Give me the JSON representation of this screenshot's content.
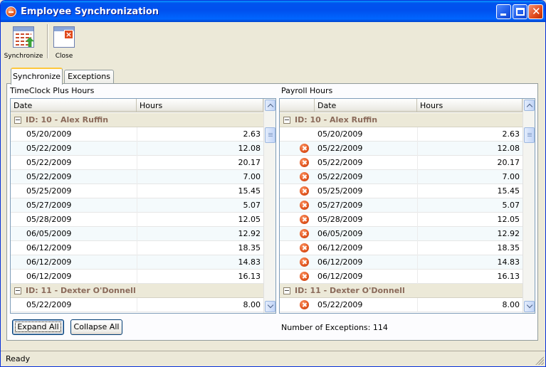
{
  "window": {
    "title": "Employee Synchronization"
  },
  "toolbar": {
    "synchronize_label": "Synchronize",
    "close_label": "Close"
  },
  "tabs": [
    {
      "label": "Synchronize",
      "active": true
    },
    {
      "label": "Exceptions",
      "active": false
    }
  ],
  "left_panel": {
    "title": "TimeClock Plus Hours",
    "columns": [
      "Date",
      "Hours"
    ],
    "groups": [
      {
        "label": "ID: 10 - Alex Ruffin",
        "rows": [
          {
            "date": "05/20/2009",
            "hours": "2.63"
          },
          {
            "date": "05/22/2009",
            "hours": "12.08"
          },
          {
            "date": "05/22/2009",
            "hours": "20.17"
          },
          {
            "date": "05/22/2009",
            "hours": "7.00"
          },
          {
            "date": "05/25/2009",
            "hours": "15.45"
          },
          {
            "date": "05/27/2009",
            "hours": "5.07"
          },
          {
            "date": "05/28/2009",
            "hours": "12.05"
          },
          {
            "date": "06/05/2009",
            "hours": "12.92"
          },
          {
            "date": "06/12/2009",
            "hours": "18.35"
          },
          {
            "date": "06/12/2009",
            "hours": "14.83"
          },
          {
            "date": "06/12/2009",
            "hours": "16.13"
          }
        ]
      },
      {
        "label": "ID: 11 - Dexter O'Donnell",
        "rows": [
          {
            "date": "05/22/2009",
            "hours": "8.00"
          }
        ]
      }
    ]
  },
  "right_panel": {
    "title": "Payroll Hours",
    "columns": [
      "",
      "Date",
      "Hours"
    ],
    "groups": [
      {
        "label": "ID: 10 - Alex Ruffin",
        "rows": [
          {
            "date": "05/20/2009",
            "hours": "2.63",
            "error": false
          },
          {
            "date": "05/22/2009",
            "hours": "12.08",
            "error": true
          },
          {
            "date": "05/22/2009",
            "hours": "20.17",
            "error": true
          },
          {
            "date": "05/22/2009",
            "hours": "7.00",
            "error": true
          },
          {
            "date": "05/25/2009",
            "hours": "15.45",
            "error": true
          },
          {
            "date": "05/27/2009",
            "hours": "5.07",
            "error": true
          },
          {
            "date": "05/28/2009",
            "hours": "12.05",
            "error": true
          },
          {
            "date": "06/05/2009",
            "hours": "12.92",
            "error": true
          },
          {
            "date": "06/12/2009",
            "hours": "18.35",
            "error": true
          },
          {
            "date": "06/12/2009",
            "hours": "14.83",
            "error": true
          },
          {
            "date": "06/12/2009",
            "hours": "16.13",
            "error": true
          }
        ]
      },
      {
        "label": "ID: 11 - Dexter O'Donnell",
        "rows": [
          {
            "date": "05/22/2009",
            "hours": "8.00",
            "error": true
          }
        ]
      }
    ]
  },
  "buttons": {
    "expand_all": "Expand All",
    "collapse_all": "Collapse All"
  },
  "exceptions": {
    "label": "Number of Exceptions: 114"
  },
  "status": {
    "text": "Ready"
  },
  "icons": {
    "app": "app-icon",
    "error": "error-icon",
    "synchronize": "synchronize-icon",
    "close": "close-icon"
  }
}
